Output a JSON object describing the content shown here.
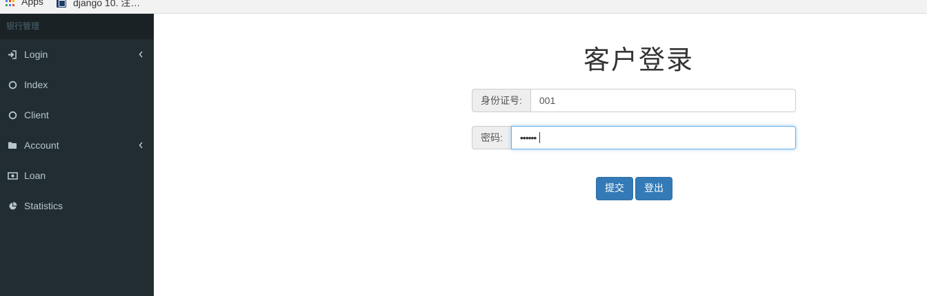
{
  "bookmarks": {
    "apps_label": "Apps",
    "page_label": "django 10. 注…",
    "apps_colors": [
      "#ea4335",
      "#fbbc05",
      "#34a853",
      "#4285f4",
      "#ea4335",
      "#fbbc05",
      "#34a853",
      "#4285f4",
      "#ea4335"
    ]
  },
  "sidebar": {
    "header": "银行管理",
    "items": [
      {
        "label": "Login",
        "icon": "sign-in-icon",
        "has_chevron": true
      },
      {
        "label": "Index",
        "icon": "circle-icon",
        "has_chevron": false
      },
      {
        "label": "Client",
        "icon": "circle-icon",
        "has_chevron": false
      },
      {
        "label": "Account",
        "icon": "folder-icon",
        "has_chevron": true
      },
      {
        "label": "Loan",
        "icon": "money-icon",
        "has_chevron": false
      },
      {
        "label": "Statistics",
        "icon": "pie-chart-icon",
        "has_chevron": false
      }
    ]
  },
  "main": {
    "title": "客户登录",
    "id_label": "身份证号:",
    "id_value": "001",
    "password_label": "密码:",
    "password_mask": "••••••",
    "submit_label": "提交",
    "logout_label": "登出"
  },
  "colors": {
    "sidebar_bg": "#222d32",
    "sidebar_header_bg": "#1a2226",
    "sidebar_text": "#b8c7ce",
    "primary_button": "#337ab7",
    "focus_border": "#66afe9"
  }
}
